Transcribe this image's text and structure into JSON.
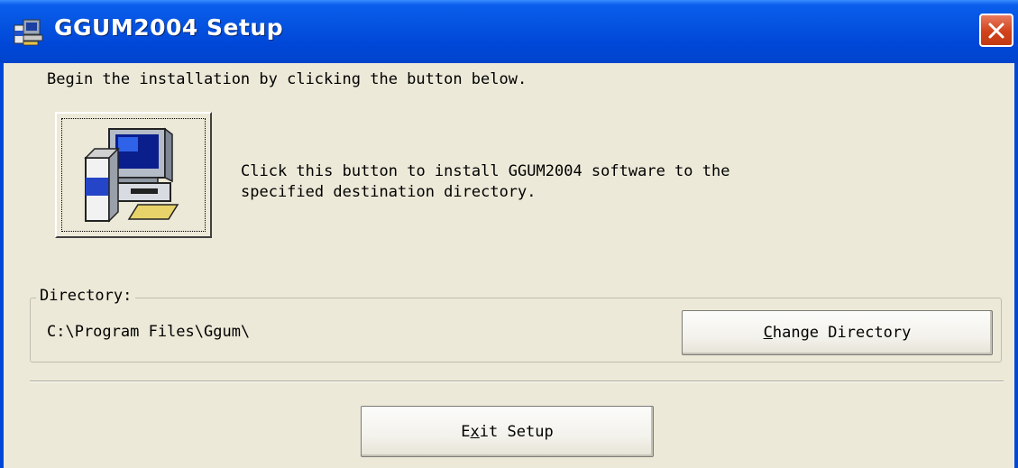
{
  "window": {
    "title": "GGUM2004 Setup",
    "icons": {
      "app": "setup-app-icon",
      "close": "close-icon",
      "install": "install-computer-icon"
    },
    "colors": {
      "titlebar": "#0047D8",
      "close_button": "#D1421B",
      "face": "#ECE9D8"
    }
  },
  "intro": {
    "text": "Begin the installation by clicking the button below."
  },
  "install": {
    "description_line1": "Click this button to install GGUM2004 software to the",
    "description_line2": "specified destination directory."
  },
  "directory": {
    "label": "Directory:",
    "path": "C:\\Program Files\\Ggum\\",
    "change_button": {
      "mnemonic": "C",
      "rest": "hange Directory"
    }
  },
  "footer": {
    "exit_button": {
      "before": "E",
      "mnemonic": "x",
      "after": "it Setup"
    }
  }
}
